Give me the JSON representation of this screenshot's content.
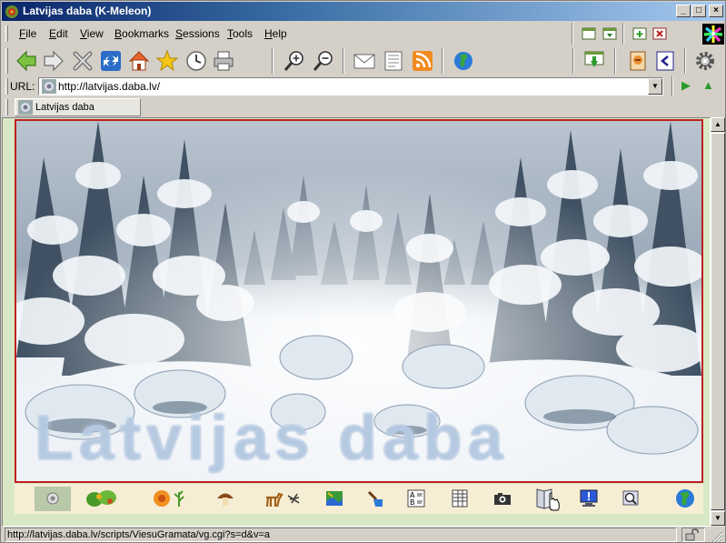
{
  "window": {
    "title": "Latvijas daba (K-Meleon)",
    "min_glyph": "_",
    "max_glyph": "□",
    "close_glyph": "×"
  },
  "menu": {
    "items": [
      {
        "label": "File",
        "accel": "F",
        "rest": "ile"
      },
      {
        "label": "Edit",
        "accel": "E",
        "rest": "dit"
      },
      {
        "label": "View",
        "accel": "V",
        "rest": "iew"
      },
      {
        "label": "Bookmarks",
        "accel": "B",
        "rest": "ookmarks"
      },
      {
        "label": "Sessions",
        "accel": "S",
        "rest": "essions"
      },
      {
        "label": "Tools",
        "accel": "T",
        "rest": "ools"
      },
      {
        "label": "Help",
        "accel": "H",
        "rest": "elp"
      }
    ]
  },
  "toolbar": {
    "buttons": [
      "back-icon",
      "forward-icon",
      "stop-icon",
      "reload-icon",
      "home-icon",
      "bookmarks-icon",
      "history-icon",
      "print-icon",
      "zoom-in-icon",
      "zoom-out-icon",
      "mail-icon",
      "news-icon",
      "rss-icon",
      "globe-icon",
      "download-icon",
      "privacy-icon",
      "source-icon",
      "settings-icon"
    ]
  },
  "urlbar": {
    "label": "URL:",
    "value": "http://latvijas.daba.lv/",
    "dropdown_glyph": "▼",
    "go_glyph": "▶",
    "up_glyph": "▲"
  },
  "tabs": [
    {
      "label": "Latvijas daba",
      "active": true
    }
  ],
  "page": {
    "banner_text": "Latvijas daba",
    "nav_icons": [
      "home-icon",
      "plants-icon",
      "flowers-icon",
      "mushroom-icon",
      "animals-icon",
      "map-icon",
      "tools-icon",
      "glossary-icon",
      "table-icon",
      "camera-icon",
      "guestbook-icon",
      "computer-icon",
      "search-icon",
      "world-icon"
    ]
  },
  "status": {
    "text": "http://latvijas.daba.lv/scripts/ViesuGramata/vg.cgi?s=d&v=a"
  },
  "colors": {
    "title_start": "#0a246a",
    "title_end": "#a6caf0",
    "banner_border": "#c02020",
    "nav_strip": "#f6eed4",
    "page_background": "#d8e8c4"
  }
}
